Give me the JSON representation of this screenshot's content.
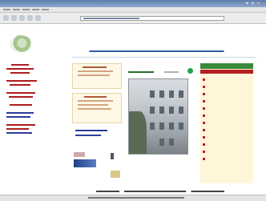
{
  "colors": {
    "title_bar": "#5d7fae",
    "sidebar_link": "#b01d1d",
    "sidebar_link_alt": "#2a3d9a",
    "right_menu_bg": "#fff6da",
    "right_menu_header": "#3a8a3a",
    "right_menu_accent": "#b61e1e",
    "search_icon": "#26a24d"
  },
  "icons": {
    "logo": "circular-emblem-icon",
    "search": "search-icon",
    "close": "close-icon"
  }
}
